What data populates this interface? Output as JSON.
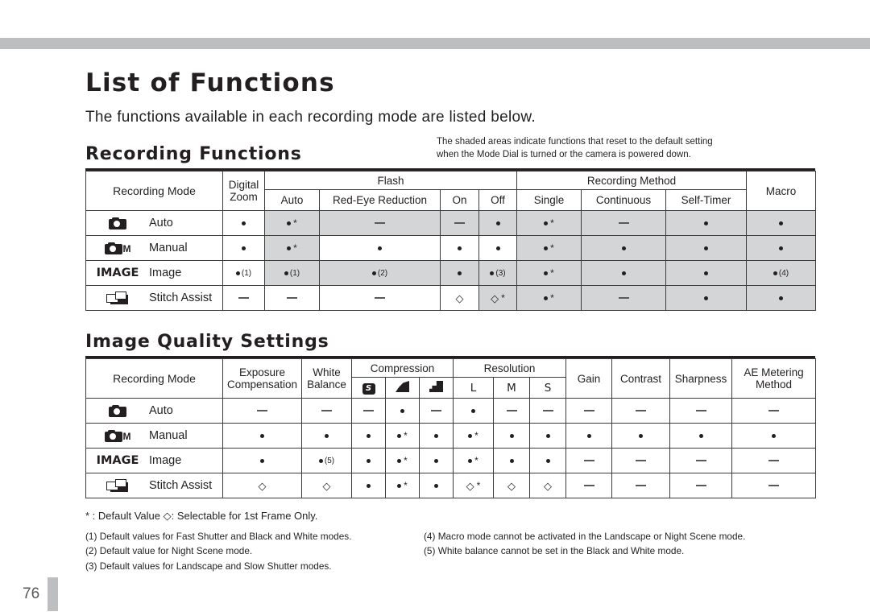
{
  "page": {
    "number": "76"
  },
  "header": {
    "title": "List of Functions",
    "subtitle": "The functions available in each recording mode are listed below."
  },
  "sections": [
    {
      "heading": "Recording Functions",
      "note_line1": "The shaded areas indicate functions that reset to the default setting",
      "note_line2": "when the Mode Dial is turned or the camera is powered  down."
    },
    {
      "heading": "Image Quality Settings"
    }
  ],
  "table1": {
    "row_header": "Recording Mode",
    "groups": [
      {
        "label": "Digital Zoom",
        "cols": 1
      },
      {
        "label": "Flash",
        "cols": 4
      },
      {
        "label": "Recording Method",
        "cols": 3
      },
      {
        "label": "Macro",
        "cols": 1
      }
    ],
    "columns": [
      "Digital\nZoom",
      "Auto",
      "Red-Eye Reduction",
      "On",
      "Off",
      "Single",
      "Continuous",
      "Self-Timer",
      "Macro"
    ],
    "subheaders": {
      "digital_zoom": "Digital Zoom",
      "digital_zoom_l1": "Digital",
      "digital_zoom_l2": "Zoom",
      "flash": "Flash",
      "flash_auto": "Auto",
      "flash_redeye": "Red-Eye Reduction",
      "flash_on": "On",
      "flash_off": "Off",
      "recording_method": "Recording Method",
      "rm_single": "Single",
      "rm_continuous": "Continuous",
      "rm_selftimer": "Self-Timer",
      "macro": "Macro"
    },
    "rows": [
      {
        "icon": "camera-auto-icon",
        "label": "Auto",
        "cells": [
          {
            "mark": "dot",
            "star": false,
            "note": "",
            "shaded": false
          },
          {
            "mark": "dot",
            "star": true,
            "note": "",
            "shaded": true
          },
          {
            "mark": "dash",
            "star": false,
            "note": "",
            "shaded": true
          },
          {
            "mark": "dash",
            "star": false,
            "note": "",
            "shaded": true
          },
          {
            "mark": "dot",
            "star": false,
            "note": "",
            "shaded": true
          },
          {
            "mark": "dot",
            "star": true,
            "note": "",
            "shaded": true
          },
          {
            "mark": "dash",
            "star": false,
            "note": "",
            "shaded": true
          },
          {
            "mark": "dot",
            "star": false,
            "note": "",
            "shaded": true
          },
          {
            "mark": "dot",
            "star": false,
            "note": "",
            "shaded": true
          }
        ]
      },
      {
        "icon": "camera-manual-icon",
        "label": "Manual",
        "cells": [
          {
            "mark": "dot",
            "star": false,
            "note": "",
            "shaded": false
          },
          {
            "mark": "dot",
            "star": true,
            "note": "",
            "shaded": true
          },
          {
            "mark": "dot",
            "star": false,
            "note": "",
            "shaded": false
          },
          {
            "mark": "dot",
            "star": false,
            "note": "",
            "shaded": false
          },
          {
            "mark": "dot",
            "star": false,
            "note": "",
            "shaded": false
          },
          {
            "mark": "dot",
            "star": true,
            "note": "",
            "shaded": true
          },
          {
            "mark": "dot",
            "star": false,
            "note": "",
            "shaded": true
          },
          {
            "mark": "dot",
            "star": false,
            "note": "",
            "shaded": true
          },
          {
            "mark": "dot",
            "star": false,
            "note": "",
            "shaded": true
          }
        ]
      },
      {
        "icon": "image-mode-icon",
        "label": "Image",
        "cells": [
          {
            "mark": "dot",
            "star": false,
            "note": "(1)",
            "shaded": false
          },
          {
            "mark": "dot",
            "star": false,
            "note": "(1)",
            "shaded": true
          },
          {
            "mark": "dot",
            "star": false,
            "note": "(2)",
            "shaded": true
          },
          {
            "mark": "dot",
            "star": false,
            "note": "",
            "shaded": true
          },
          {
            "mark": "dot",
            "star": false,
            "note": "(3)",
            "shaded": true
          },
          {
            "mark": "dot",
            "star": true,
            "note": "",
            "shaded": true
          },
          {
            "mark": "dot",
            "star": false,
            "note": "",
            "shaded": true
          },
          {
            "mark": "dot",
            "star": false,
            "note": "",
            "shaded": true
          },
          {
            "mark": "dot",
            "star": false,
            "note": "(4)",
            "shaded": true
          }
        ]
      },
      {
        "icon": "stitch-assist-icon",
        "label": "Stitch Assist",
        "cells": [
          {
            "mark": "dash",
            "star": false,
            "note": "",
            "shaded": false
          },
          {
            "mark": "dash",
            "star": false,
            "note": "",
            "shaded": false
          },
          {
            "mark": "dash",
            "star": false,
            "note": "",
            "shaded": false
          },
          {
            "mark": "diamond",
            "star": false,
            "note": "",
            "shaded": false
          },
          {
            "mark": "diamond",
            "star": true,
            "note": "",
            "shaded": true
          },
          {
            "mark": "dot",
            "star": true,
            "note": "",
            "shaded": true
          },
          {
            "mark": "dash",
            "star": false,
            "note": "",
            "shaded": true
          },
          {
            "mark": "dot",
            "star": false,
            "note": "",
            "shaded": true
          },
          {
            "mark": "dot",
            "star": false,
            "note": "",
            "shaded": true
          }
        ]
      }
    ]
  },
  "table2": {
    "row_header": "Recording Mode",
    "subheaders": {
      "exposure_l1": "Exposure",
      "exposure_l2": "Compensation",
      "wb_l1": "White",
      "wb_l2": "Balance",
      "compression": "Compression",
      "comp_superfine": "superfine-icon",
      "comp_fine": "fine-icon",
      "comp_normal": "normal-icon",
      "resolution": "Resolution",
      "res_l": "L",
      "res_m": "M",
      "res_s": "S",
      "gain": "Gain",
      "contrast": "Contrast",
      "sharpness": "Sharpness",
      "ae_l1": "AE Metering",
      "ae_l2": "Method"
    },
    "rows": [
      {
        "icon": "camera-auto-icon",
        "label": "Auto",
        "cells": [
          {
            "mark": "dash",
            "star": false,
            "note": ""
          },
          {
            "mark": "dash",
            "star": false,
            "note": ""
          },
          {
            "mark": "dash",
            "star": false,
            "note": ""
          },
          {
            "mark": "dot",
            "star": false,
            "note": ""
          },
          {
            "mark": "dash",
            "star": false,
            "note": ""
          },
          {
            "mark": "dot",
            "star": false,
            "note": ""
          },
          {
            "mark": "dash",
            "star": false,
            "note": ""
          },
          {
            "mark": "dash",
            "star": false,
            "note": ""
          },
          {
            "mark": "dash",
            "star": false,
            "note": ""
          },
          {
            "mark": "dash",
            "star": false,
            "note": ""
          },
          {
            "mark": "dash",
            "star": false,
            "note": ""
          },
          {
            "mark": "dash",
            "star": false,
            "note": ""
          }
        ]
      },
      {
        "icon": "camera-manual-icon",
        "label": "Manual",
        "cells": [
          {
            "mark": "dot",
            "star": false,
            "note": ""
          },
          {
            "mark": "dot",
            "star": false,
            "note": ""
          },
          {
            "mark": "dot",
            "star": false,
            "note": ""
          },
          {
            "mark": "dot",
            "star": true,
            "note": ""
          },
          {
            "mark": "dot",
            "star": false,
            "note": ""
          },
          {
            "mark": "dot",
            "star": true,
            "note": ""
          },
          {
            "mark": "dot",
            "star": false,
            "note": ""
          },
          {
            "mark": "dot",
            "star": false,
            "note": ""
          },
          {
            "mark": "dot",
            "star": false,
            "note": ""
          },
          {
            "mark": "dot",
            "star": false,
            "note": ""
          },
          {
            "mark": "dot",
            "star": false,
            "note": ""
          },
          {
            "mark": "dot",
            "star": false,
            "note": ""
          }
        ]
      },
      {
        "icon": "image-mode-icon",
        "label": "Image",
        "cells": [
          {
            "mark": "dot",
            "star": false,
            "note": ""
          },
          {
            "mark": "dot",
            "star": false,
            "note": "(5)"
          },
          {
            "mark": "dot",
            "star": false,
            "note": ""
          },
          {
            "mark": "dot",
            "star": true,
            "note": ""
          },
          {
            "mark": "dot",
            "star": false,
            "note": ""
          },
          {
            "mark": "dot",
            "star": true,
            "note": ""
          },
          {
            "mark": "dot",
            "star": false,
            "note": ""
          },
          {
            "mark": "dot",
            "star": false,
            "note": ""
          },
          {
            "mark": "dash",
            "star": false,
            "note": ""
          },
          {
            "mark": "dash",
            "star": false,
            "note": ""
          },
          {
            "mark": "dash",
            "star": false,
            "note": ""
          },
          {
            "mark": "dash",
            "star": false,
            "note": ""
          }
        ]
      },
      {
        "icon": "stitch-assist-icon",
        "label": "Stitch Assist",
        "cells": [
          {
            "mark": "diamond",
            "star": false,
            "note": ""
          },
          {
            "mark": "diamond",
            "star": false,
            "note": ""
          },
          {
            "mark": "dot",
            "star": false,
            "note": ""
          },
          {
            "mark": "dot",
            "star": true,
            "note": ""
          },
          {
            "mark": "dot",
            "star": false,
            "note": ""
          },
          {
            "mark": "diamond",
            "star": true,
            "note": ""
          },
          {
            "mark": "diamond",
            "star": false,
            "note": ""
          },
          {
            "mark": "diamond",
            "star": false,
            "note": ""
          },
          {
            "mark": "dash",
            "star": false,
            "note": ""
          },
          {
            "mark": "dash",
            "star": false,
            "note": ""
          },
          {
            "mark": "dash",
            "star": false,
            "note": ""
          },
          {
            "mark": "dash",
            "star": false,
            "note": ""
          }
        ]
      }
    ]
  },
  "footnotes": {
    "legend": "* : Default Value    ◇: Selectable for 1st Frame Only.",
    "left": [
      "(1) Default values for Fast Shutter and Black and White modes.",
      "(2) Default value for Night Scene mode.",
      "(3) Default values for Landscape and Slow Shutter modes."
    ],
    "right": [
      "(4) Macro mode cannot be activated in the Landscape or Night Scene mode.",
      "(5) White balance cannot be set in the Black and White mode."
    ]
  }
}
